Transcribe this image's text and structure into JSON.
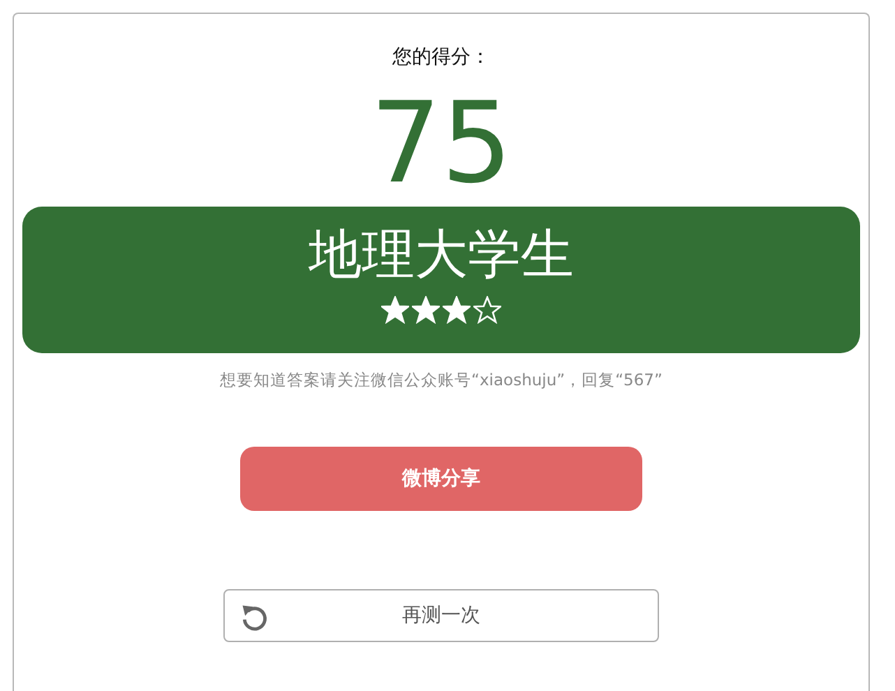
{
  "heading": "您的得分：",
  "score": "75",
  "result": {
    "title": "地理大学生",
    "stars": 3
  },
  "hint": "想要知道答案请关注微信公众账号“xiaoshuju”，回复“567”",
  "share_button": "微博分享",
  "retry_button": "再测一次"
}
